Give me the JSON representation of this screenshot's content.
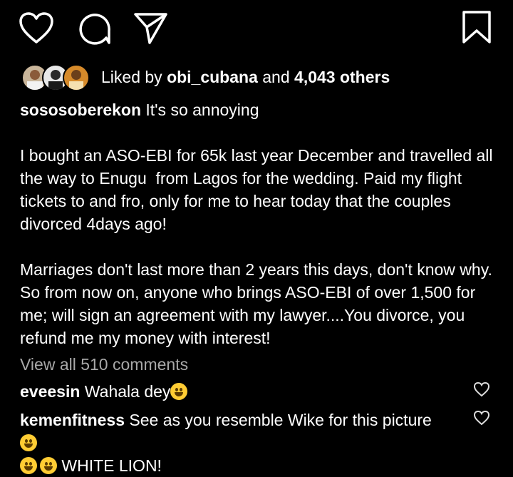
{
  "post": {
    "liked_by_prefix": "Liked by ",
    "liked_by_user": "obi_cubana",
    "liked_by_and": " and ",
    "liked_by_others": "4,043 others",
    "caption_user": "sososoberekon",
    "caption_text": " It's so annoying\n\nI bought an ASO-EBI for 65k last year December and travelled all the way to Enugu  from Lagos for the wedding. Paid my flight tickets to and fro, only for me to hear today that the couples divorced 4days ago!\n\nMarriages don't last more than 2 years this days, don't know why. So from now on, anyone who brings ASO-EBI of over 1,500 for me; will sign an agreement with my lawyer....You divorce, you refund me my money with interest!",
    "view_all_comments": "View all 510 comments"
  },
  "comments": [
    {
      "user": "eveesin",
      "text": " Wahala dey",
      "emoji": "rolling-laughing-emoji"
    },
    {
      "user": "kemenfitness",
      "text": " See as you resemble Wike for this picture ",
      "text2": " WHITE LION!",
      "emoji": "grinning-emoji"
    }
  ],
  "icons": {
    "like": "heart-icon",
    "comment": "comment-icon",
    "share": "send-icon",
    "save": "bookmark-icon",
    "comment_like": "heart-icon"
  },
  "colors": {
    "background": "#000000",
    "text": "#ffffff",
    "muted": "#a8a8a8"
  }
}
